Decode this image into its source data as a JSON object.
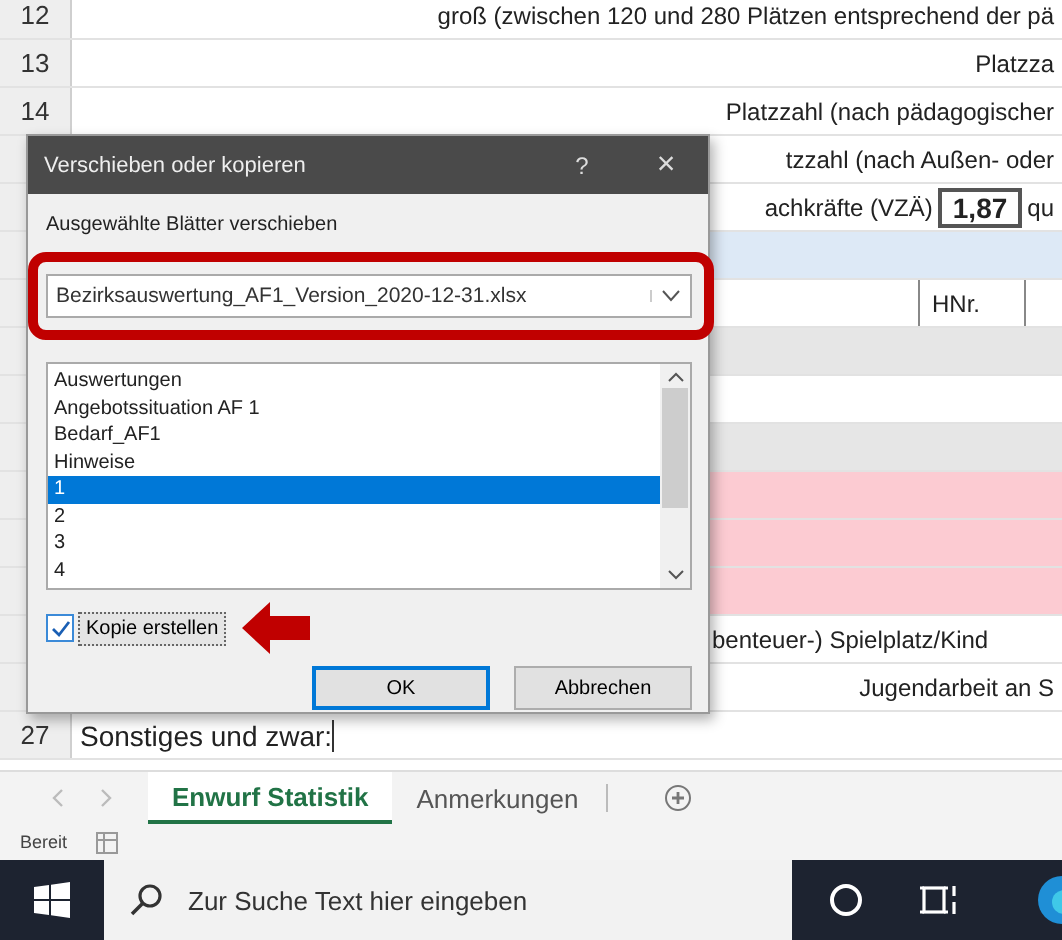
{
  "sheet": {
    "rows": [
      {
        "number": "12",
        "kind": "text",
        "text": "groß (zwischen 120 und 280 Plätzen entsprechend der pä"
      },
      {
        "number": "13",
        "kind": "text",
        "text": "Platzza"
      },
      {
        "number": "14",
        "kind": "text",
        "text": "Platzzahl (nach pädagogischer"
      },
      {
        "kind": "text",
        "text": "tzzahl (nach Außen- oder"
      },
      {
        "kind": "value",
        "text": "achkräfte (VZÄ)",
        "value": "1,87",
        "suffix": "qu"
      },
      {
        "kind": "empty",
        "color": "#dde9f6"
      },
      {
        "kind": "cell",
        "value": "HNr."
      },
      {
        "kind": "empty",
        "color": "#e6e6e6"
      },
      {
        "kind": "empty"
      },
      {
        "kind": "empty",
        "color": "#e6e6e6"
      },
      {
        "kind": "empty",
        "color": "#fccbd2"
      },
      {
        "kind": "empty",
        "color": "#fccbd2"
      },
      {
        "kind": "empty",
        "color": "#fccbd2"
      },
      {
        "kind": "left",
        "text": "benteuer-) Spielplatz/Kind"
      },
      {
        "kind": "text",
        "text": "Jugendarbeit an S"
      },
      {
        "number": "27",
        "kind": "input",
        "text": "Sonstiges und zwar:"
      }
    ]
  },
  "dialog": {
    "title": "Verschieben oder kopieren",
    "help": "?",
    "close": "×",
    "heading": "Ausgewählte Blätter verschieben",
    "workbook": {
      "value": "Bezirksauswertung_AF1_Version_2020-12-31.xlsx"
    },
    "sheets": [
      {
        "label": "Auswertungen",
        "selected": false
      },
      {
        "label": "Angebotssituation AF 1",
        "selected": false
      },
      {
        "label": "Bedarf_AF1",
        "selected": false
      },
      {
        "label": "Hinweise",
        "selected": false
      },
      {
        "label": "1",
        "selected": true
      },
      {
        "label": "2",
        "selected": false
      },
      {
        "label": "3",
        "selected": false
      },
      {
        "label": "4",
        "selected": false
      }
    ],
    "copy": {
      "label": "Kopie erstellen",
      "checked": true
    },
    "buttons": [
      "OK",
      "Abbrechen"
    ]
  },
  "sheet_tabs": [
    {
      "label": "Enwurf Statistik",
      "selected": true
    },
    {
      "label": "Anmerkungen",
      "selected": false
    }
  ],
  "status_bar": {
    "text": "Bereit"
  },
  "taskbar": {
    "search": {
      "placeholder": "Zur Suche Text hier eingeben"
    }
  }
}
